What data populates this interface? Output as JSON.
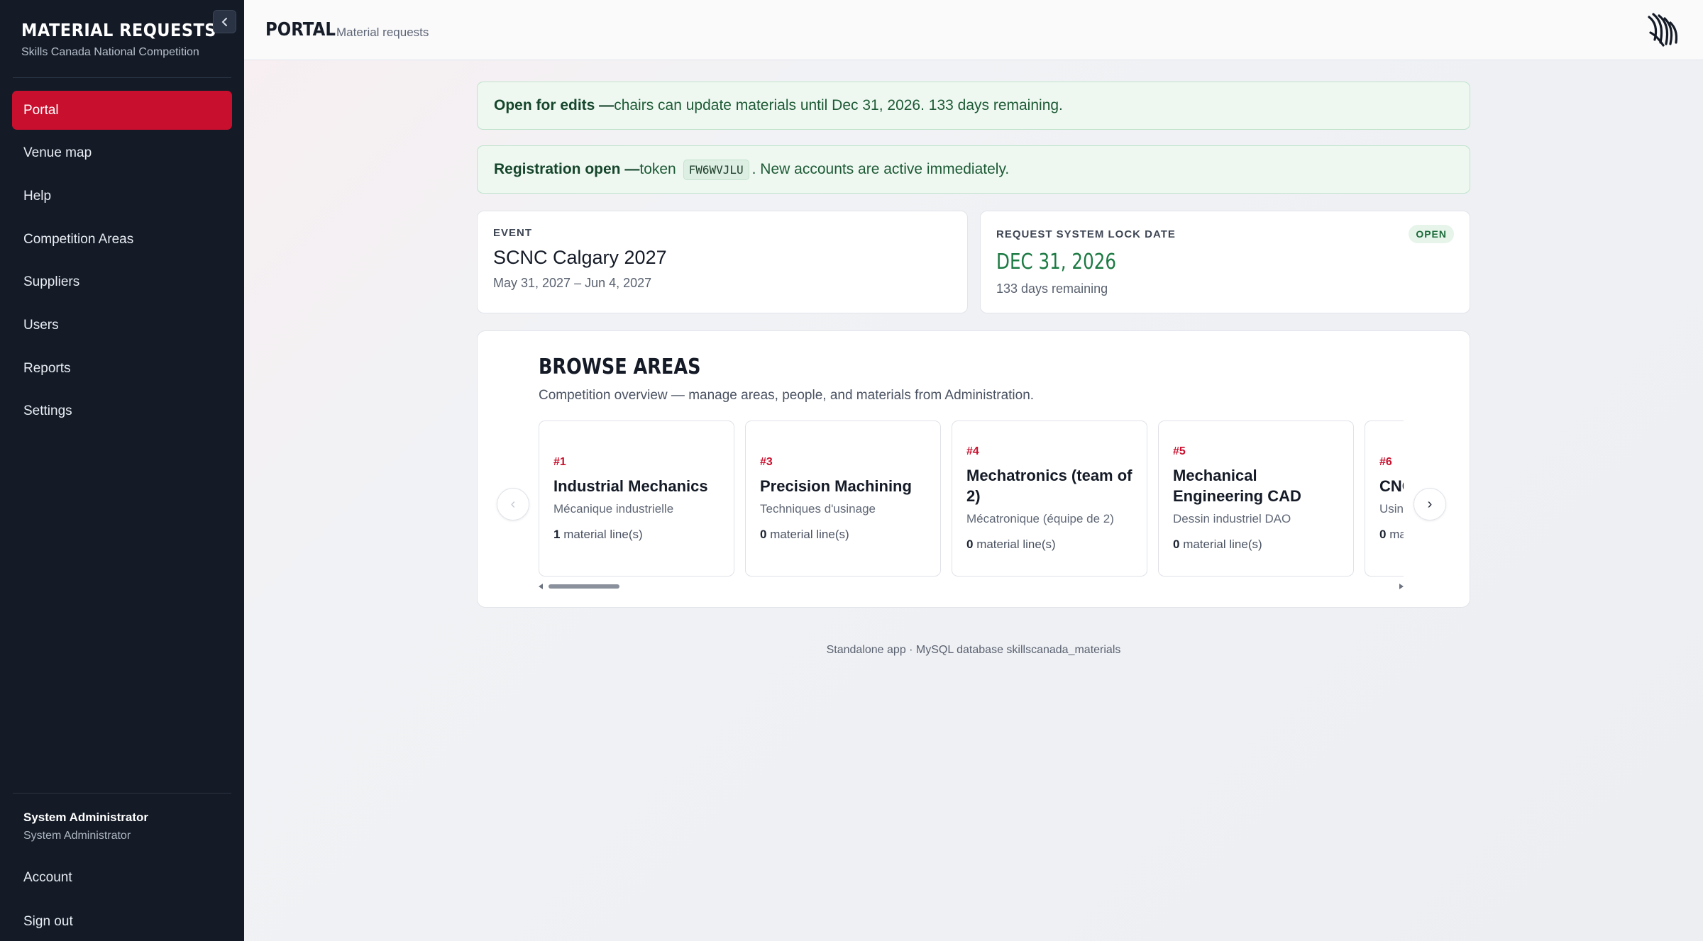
{
  "sidebar": {
    "brand_title": "MATERIAL REQUESTS",
    "brand_subtitle": "Skills Canada National Competition",
    "collapse_icon": "chevron-left-icon",
    "items": [
      {
        "label": "Portal",
        "active": true
      },
      {
        "label": "Venue map",
        "active": false
      },
      {
        "label": "Help",
        "active": false
      },
      {
        "label": "Competition Areas",
        "active": false
      },
      {
        "label": "Suppliers",
        "active": false
      },
      {
        "label": "Users",
        "active": false
      },
      {
        "label": "Reports",
        "active": false
      },
      {
        "label": "Settings",
        "active": false
      }
    ],
    "user": {
      "name": "System Administrator",
      "role": "System Administrator"
    },
    "account_label": "Account",
    "signout_label": "Sign out"
  },
  "header": {
    "title": "PORTAL",
    "subtitle": "Material requests",
    "logo_icon": "skills-canada-logo-icon"
  },
  "banners": {
    "edits": {
      "strong": "Open for edits —",
      "text": " chairs can update materials until Dec 31, 2026. 133 days remaining."
    },
    "registration": {
      "strong": "Registration open —",
      "text_before": " token",
      "token": "FW6WVJLU",
      "text_after": ". New accounts are active immediately."
    }
  },
  "event": {
    "label": "EVENT",
    "name": "SCNC Calgary 2027",
    "dates": "May 31, 2027 – Jun 4, 2027"
  },
  "lock": {
    "label": "REQUEST SYSTEM LOCK DATE",
    "badge": "OPEN",
    "date": "DEC 31, 2026",
    "remaining": "133 days remaining"
  },
  "browse": {
    "title": "BROWSE AREAS",
    "subtitle": "Competition overview — manage areas, people, and materials from Administration.",
    "prev_icon": "‹",
    "next_icon": "›",
    "lines_suffix": " material line(s)",
    "areas": [
      {
        "num": "#1",
        "name": "Industrial Mechanics",
        "fr": "Mécanique industrielle",
        "lines": "1"
      },
      {
        "num": "#3",
        "name": "Precision Machining",
        "fr": "Techniques d'usinage",
        "lines": "0"
      },
      {
        "num": "#4",
        "name": "Mechatronics (team of 2)",
        "fr": "Mécatronique (équipe de 2)",
        "lines": "0"
      },
      {
        "num": "#5",
        "name": "Mechanical Engineering CAD",
        "fr": "Dessin industriel DAO",
        "lines": "0"
      },
      {
        "num": "#6",
        "name": "CNC Machining",
        "fr": "Usinage CNC",
        "lines": "0"
      }
    ]
  },
  "footer": "Standalone app · MySQL database skillscanada_materials"
}
